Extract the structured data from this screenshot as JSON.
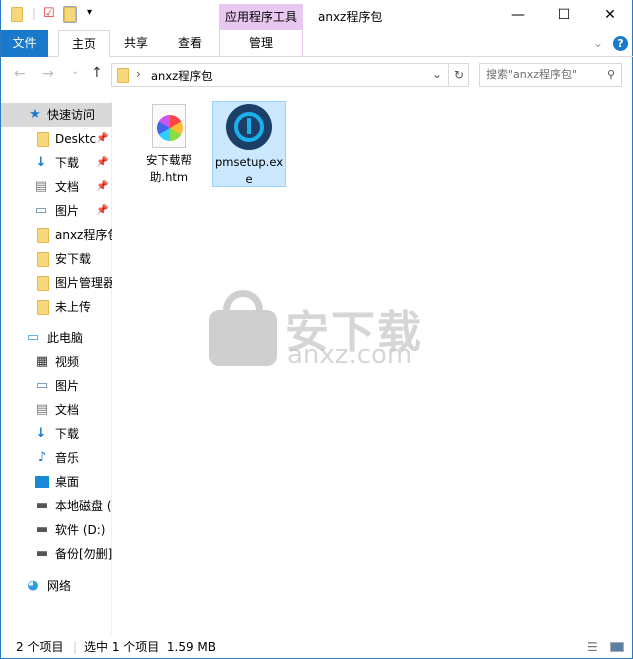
{
  "window": {
    "title": "anxz程序包",
    "context_tab": "应用程序工具",
    "minimize": "—",
    "maximize": "☐",
    "close": "✕"
  },
  "ribbon": {
    "tabs": [
      {
        "label": "文件"
      },
      {
        "label": "主页"
      },
      {
        "label": "共享"
      },
      {
        "label": "查看"
      },
      {
        "label": "管理"
      }
    ],
    "help": "?",
    "collapse": "⌄"
  },
  "address": {
    "back": "←",
    "forward": "→",
    "recent": "⌄",
    "up": "↑",
    "separator": "›",
    "path": "anxz程序包",
    "dropdown": "⌄",
    "refresh": "↻",
    "search_placeholder": "搜索\"anxz程序包\"",
    "search_icon": "⚲"
  },
  "nav": {
    "quick_access": {
      "label": "快速访问",
      "items": [
        {
          "label": "Desktc",
          "icon": "folder",
          "pinned": true
        },
        {
          "label": "下载",
          "icon": "download",
          "pinned": true
        },
        {
          "label": "文档",
          "icon": "document",
          "pinned": true
        },
        {
          "label": "图片",
          "icon": "picture",
          "pinned": true
        },
        {
          "label": "anxz程序包",
          "icon": "folder",
          "pinned": false
        },
        {
          "label": "安下载",
          "icon": "folder",
          "pinned": false
        },
        {
          "label": "图片管理器",
          "icon": "folder",
          "pinned": false
        },
        {
          "label": "未上传",
          "icon": "folder",
          "pinned": false
        }
      ]
    },
    "this_pc": {
      "label": "此电脑",
      "items": [
        {
          "label": "视频",
          "icon": "video"
        },
        {
          "label": "图片",
          "icon": "picture"
        },
        {
          "label": "文档",
          "icon": "document"
        },
        {
          "label": "下载",
          "icon": "download"
        },
        {
          "label": "音乐",
          "icon": "music"
        },
        {
          "label": "桌面",
          "icon": "desktop"
        },
        {
          "label": "本地磁盘 (C:)",
          "icon": "drive"
        },
        {
          "label": "软件 (D:)",
          "icon": "drive"
        },
        {
          "label": "备份[勿删]",
          "icon": "drive"
        }
      ]
    },
    "network": {
      "label": "网络"
    }
  },
  "files": [
    {
      "name": "安下载帮助.htm",
      "icon": "htm-file",
      "selected": false
    },
    {
      "name": "pmsetup.exe",
      "icon": "power-app",
      "selected": true
    }
  ],
  "watermark": {
    "text": "安下载",
    "sub": "anxz.com"
  },
  "status": {
    "count": "2 个项目",
    "selected": "选中 1 个项目  1.59 MB"
  },
  "colors": {
    "accent": "#1979ca",
    "selection": "#cce8ff",
    "context_tab": "#e8c8f0"
  }
}
